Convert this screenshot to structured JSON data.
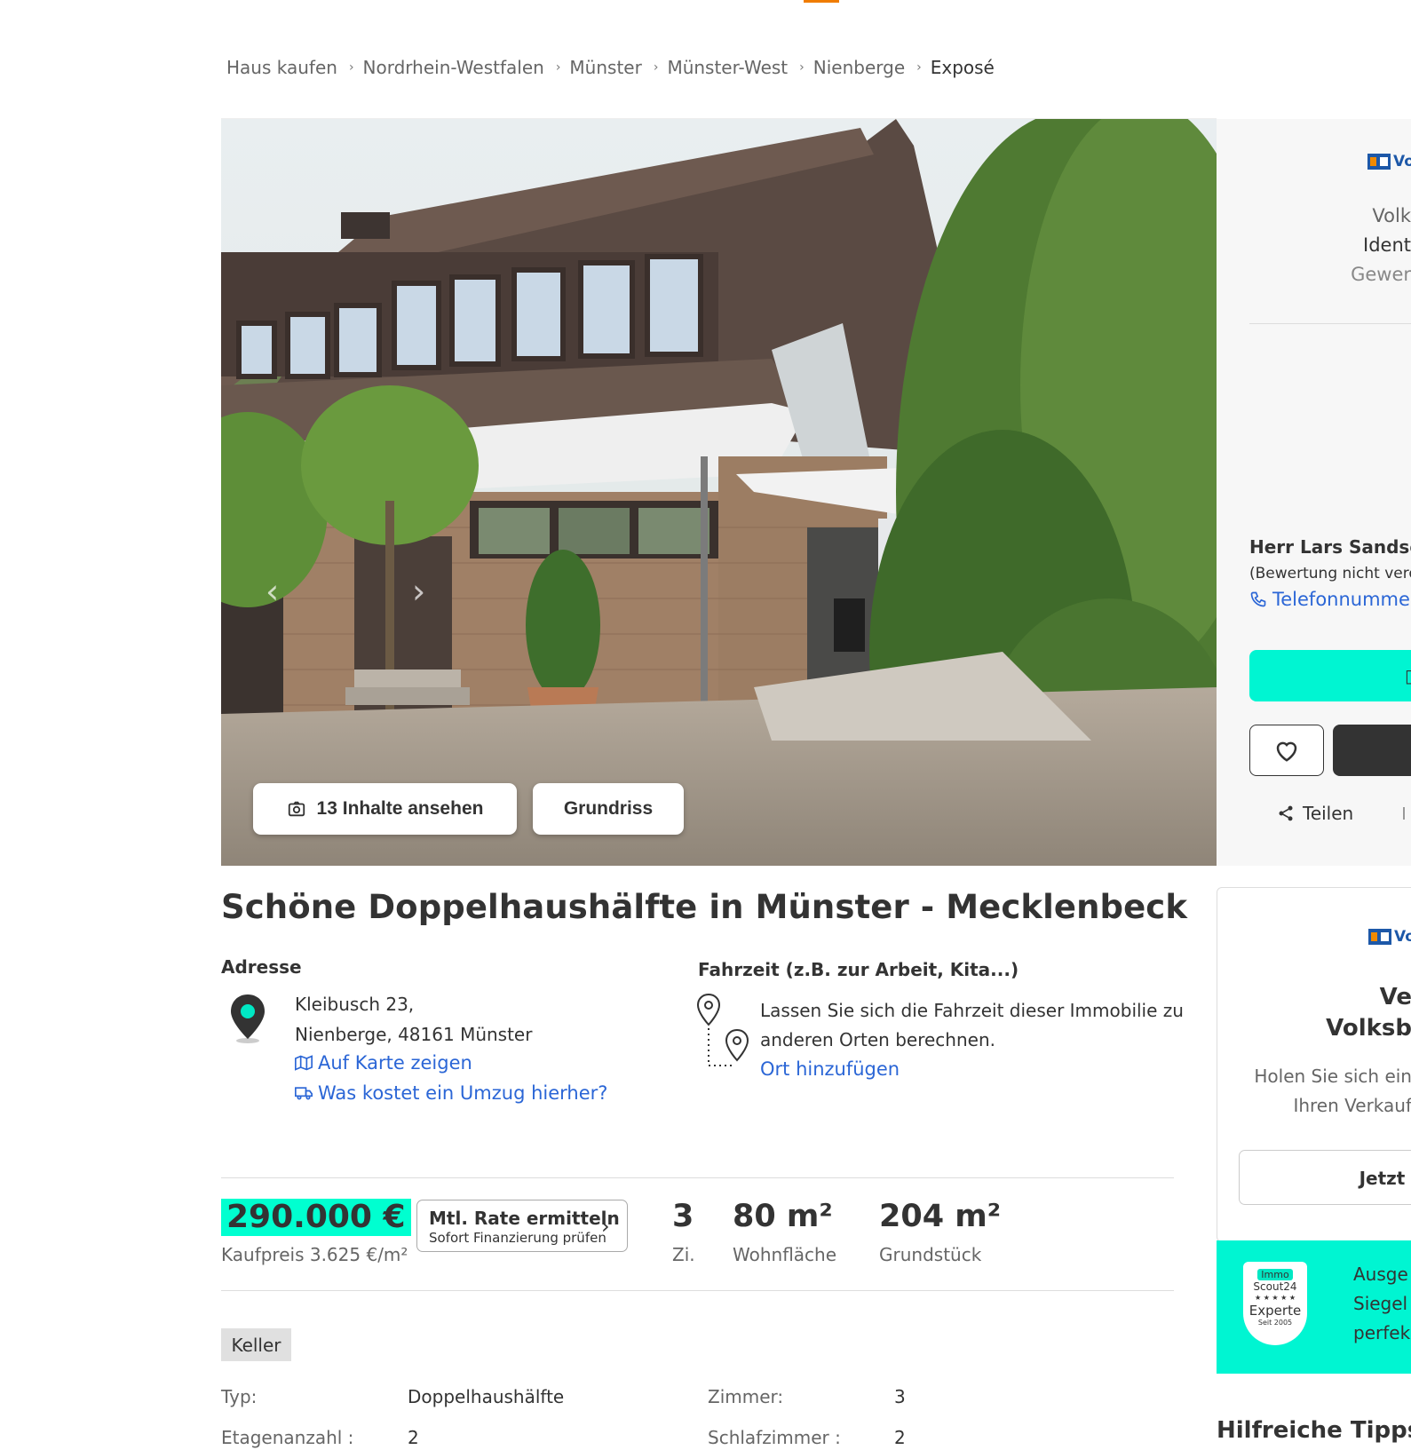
{
  "breadcrumb": [
    "Haus kaufen",
    "Nordrhein-Westfalen",
    "Münster",
    "Münster-West",
    "Nienberge",
    "Exposé"
  ],
  "gallery": {
    "media_button": "13 Inhalte ansehen",
    "floorplan_button": "Grundriss"
  },
  "contact": {
    "bank_logo_text": "Vo",
    "company_line1": "Volk",
    "company_line2": "Ident",
    "company_line3": "Gewer",
    "agent_name": "Herr Lars Sandsch",
    "rating_note": "(Bewertung nicht verö",
    "phone_link": "Telefonnummer",
    "share_label": "Teilen"
  },
  "promo": {
    "bank_logo_text": "Vo",
    "heading_line1": "Ve",
    "heading_line2": "Volksb",
    "text_line1": "Holen Sie sich ein",
    "text_line2": "Ihren Verkauf",
    "button": "Jetzt E"
  },
  "badge": {
    "brand_top": "Immo",
    "brand_bottom": "Scout24",
    "stars": "★ ★ ★ ★ ★",
    "title": "Experte",
    "since": "Seit 2005",
    "text_line1": "Ausge",
    "text_line2": "Siegel",
    "text_line3": "perfek"
  },
  "helpful_tips": "Hilfreiche Tipps z",
  "title": "Schöne Doppelhaushälfte in Münster - Mecklenbeck",
  "address": {
    "label": "Adresse",
    "line1": "Kleibusch 23,",
    "line2": "Nienberge, 48161 Münster",
    "map_link": "Auf Karte zeigen",
    "moving_link": "Was kostet ein Umzug hierher?"
  },
  "commute": {
    "label": "Fahrzeit (z.B. zur Arbeit, Kita...)",
    "text_line1": "Lassen Sie sich die Fahrzeit dieser Immobilie zu",
    "text_line2": "anderen Orten berechnen.",
    "link": "Ort hinzufügen"
  },
  "key_facts": {
    "price": "290.000 €",
    "price_sub": "Kaufpreis 3.625 €/m²",
    "rate_title": "Mtl. Rate ermitteln",
    "rate_sub": "Sofort Finanzierung prüfen",
    "rooms": "3",
    "rooms_label": "Zi.",
    "living_area": "80 m²",
    "living_area_label": "Wohnfläche",
    "plot": "204 m²",
    "plot_label": "Grundstück"
  },
  "tags": [
    "Keller"
  ],
  "details": {
    "type_label": "Typ:",
    "type_value": "Doppelhaushälfte",
    "floors_label": "Etagenanzahl :",
    "floors_value": "2",
    "rooms_label": "Zimmer:",
    "rooms_value": "3",
    "bedrooms_label": "Schlafzimmer :",
    "bedrooms_value": "2"
  },
  "colors": {
    "accent": "#00ffd0",
    "link": "#2b66d6",
    "brand_orange": "#f07c00"
  }
}
